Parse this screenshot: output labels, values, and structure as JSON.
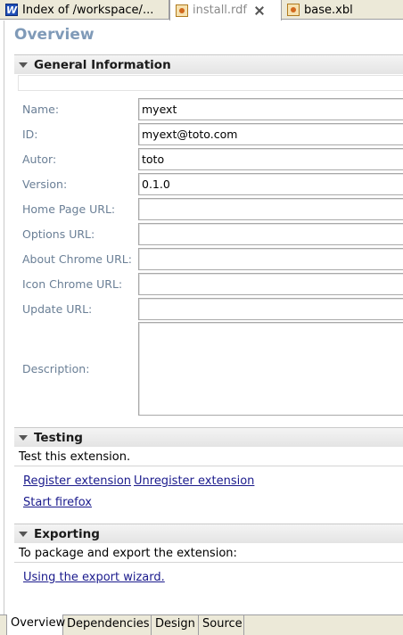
{
  "tabs": [
    {
      "label": "Index of /workspace/...",
      "icon": "w-doc-icon"
    },
    {
      "label": "install.rdf",
      "icon": "rdf-doc-icon",
      "close_icon": "close-icon"
    },
    {
      "label": "base.xbl",
      "icon": "xbl-doc-icon"
    }
  ],
  "page_title": "Overview",
  "general": {
    "title": "General Information",
    "fields": {
      "name": {
        "label": "Name:",
        "value": "myext"
      },
      "id": {
        "label": "ID:",
        "value": "myext@toto.com"
      },
      "autor": {
        "label": "Autor:",
        "value": "toto"
      },
      "version": {
        "label": "Version:",
        "value": "0.1.0"
      },
      "homepage": {
        "label": "Home Page URL:",
        "value": ""
      },
      "options": {
        "label": "Options URL:",
        "value": ""
      },
      "aboutchrome": {
        "label": "About Chrome URL:",
        "value": ""
      },
      "iconchrome": {
        "label": "Icon Chrome URL:",
        "value": ""
      },
      "update": {
        "label": "Update URL:",
        "value": ""
      },
      "description": {
        "label": "Description:",
        "value": ""
      }
    }
  },
  "testing": {
    "title": "Testing",
    "text": "Test this extension.",
    "register": "Register extension",
    "unregister": "Unregister extension",
    "start": "Start firefox"
  },
  "exporting": {
    "title": "Exporting",
    "text": "To package and export the extension:",
    "wizard": "Using the export wizard."
  },
  "bottom_tabs": [
    "Overview",
    "Dependencies",
    "Design",
    "Source"
  ],
  "colors": {
    "label_blue": "#6a7f96",
    "title_blue": "#7f9ab8",
    "link": "#1a1a8c"
  }
}
